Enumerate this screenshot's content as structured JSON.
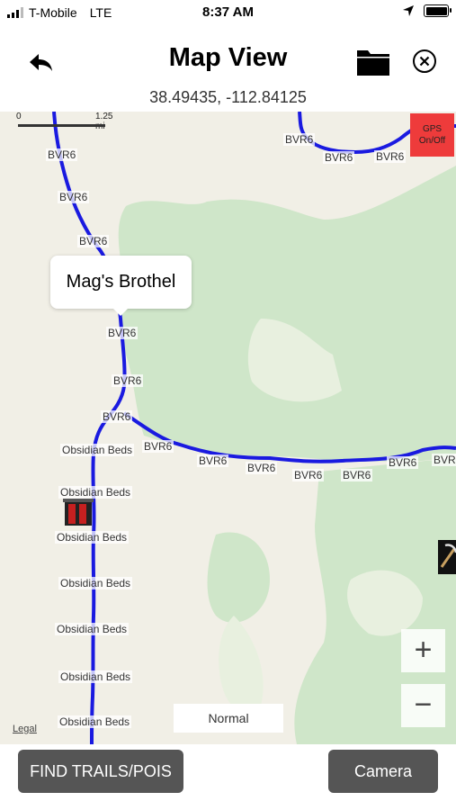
{
  "status_bar": {
    "carrier": "T-Mobile",
    "network": "LTE",
    "time": "8:37 AM"
  },
  "header": {
    "title": "Map View",
    "coordinates": "38.49435, -112.84125"
  },
  "map": {
    "scale": {
      "start": "0",
      "end": "1.25 mi"
    },
    "gps_button": {
      "line1": "GPS",
      "line2": "On/Off",
      "color": "#ee3b3b"
    },
    "callout": "Mag's Brothel",
    "route_color": "#1a1ae0",
    "road_labels": {
      "bvr6": "BVR6",
      "obsidian": "Obsidian Beds"
    },
    "zoom_in": "+",
    "zoom_out": "−",
    "map_type": "Normal",
    "legal": "Legal"
  },
  "footer": {
    "find_button": "FIND TRAILS/POIS",
    "camera_button": "Camera"
  }
}
